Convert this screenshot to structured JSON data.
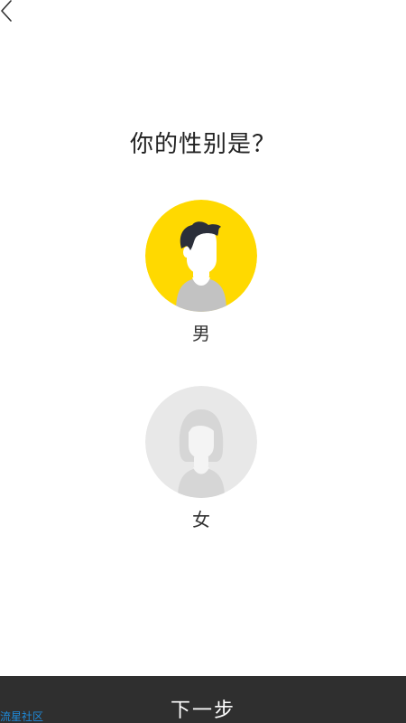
{
  "question": {
    "title": "你的性别是？"
  },
  "options": [
    {
      "label": "男",
      "selected": true,
      "accent_color": "#FFD900"
    },
    {
      "label": "女",
      "selected": false,
      "accent_color": "#E8E8E8"
    }
  ],
  "footer": {
    "next_label": "下一步",
    "watermark": "流星社区"
  },
  "icons": {
    "back": "back-chevron-icon"
  }
}
